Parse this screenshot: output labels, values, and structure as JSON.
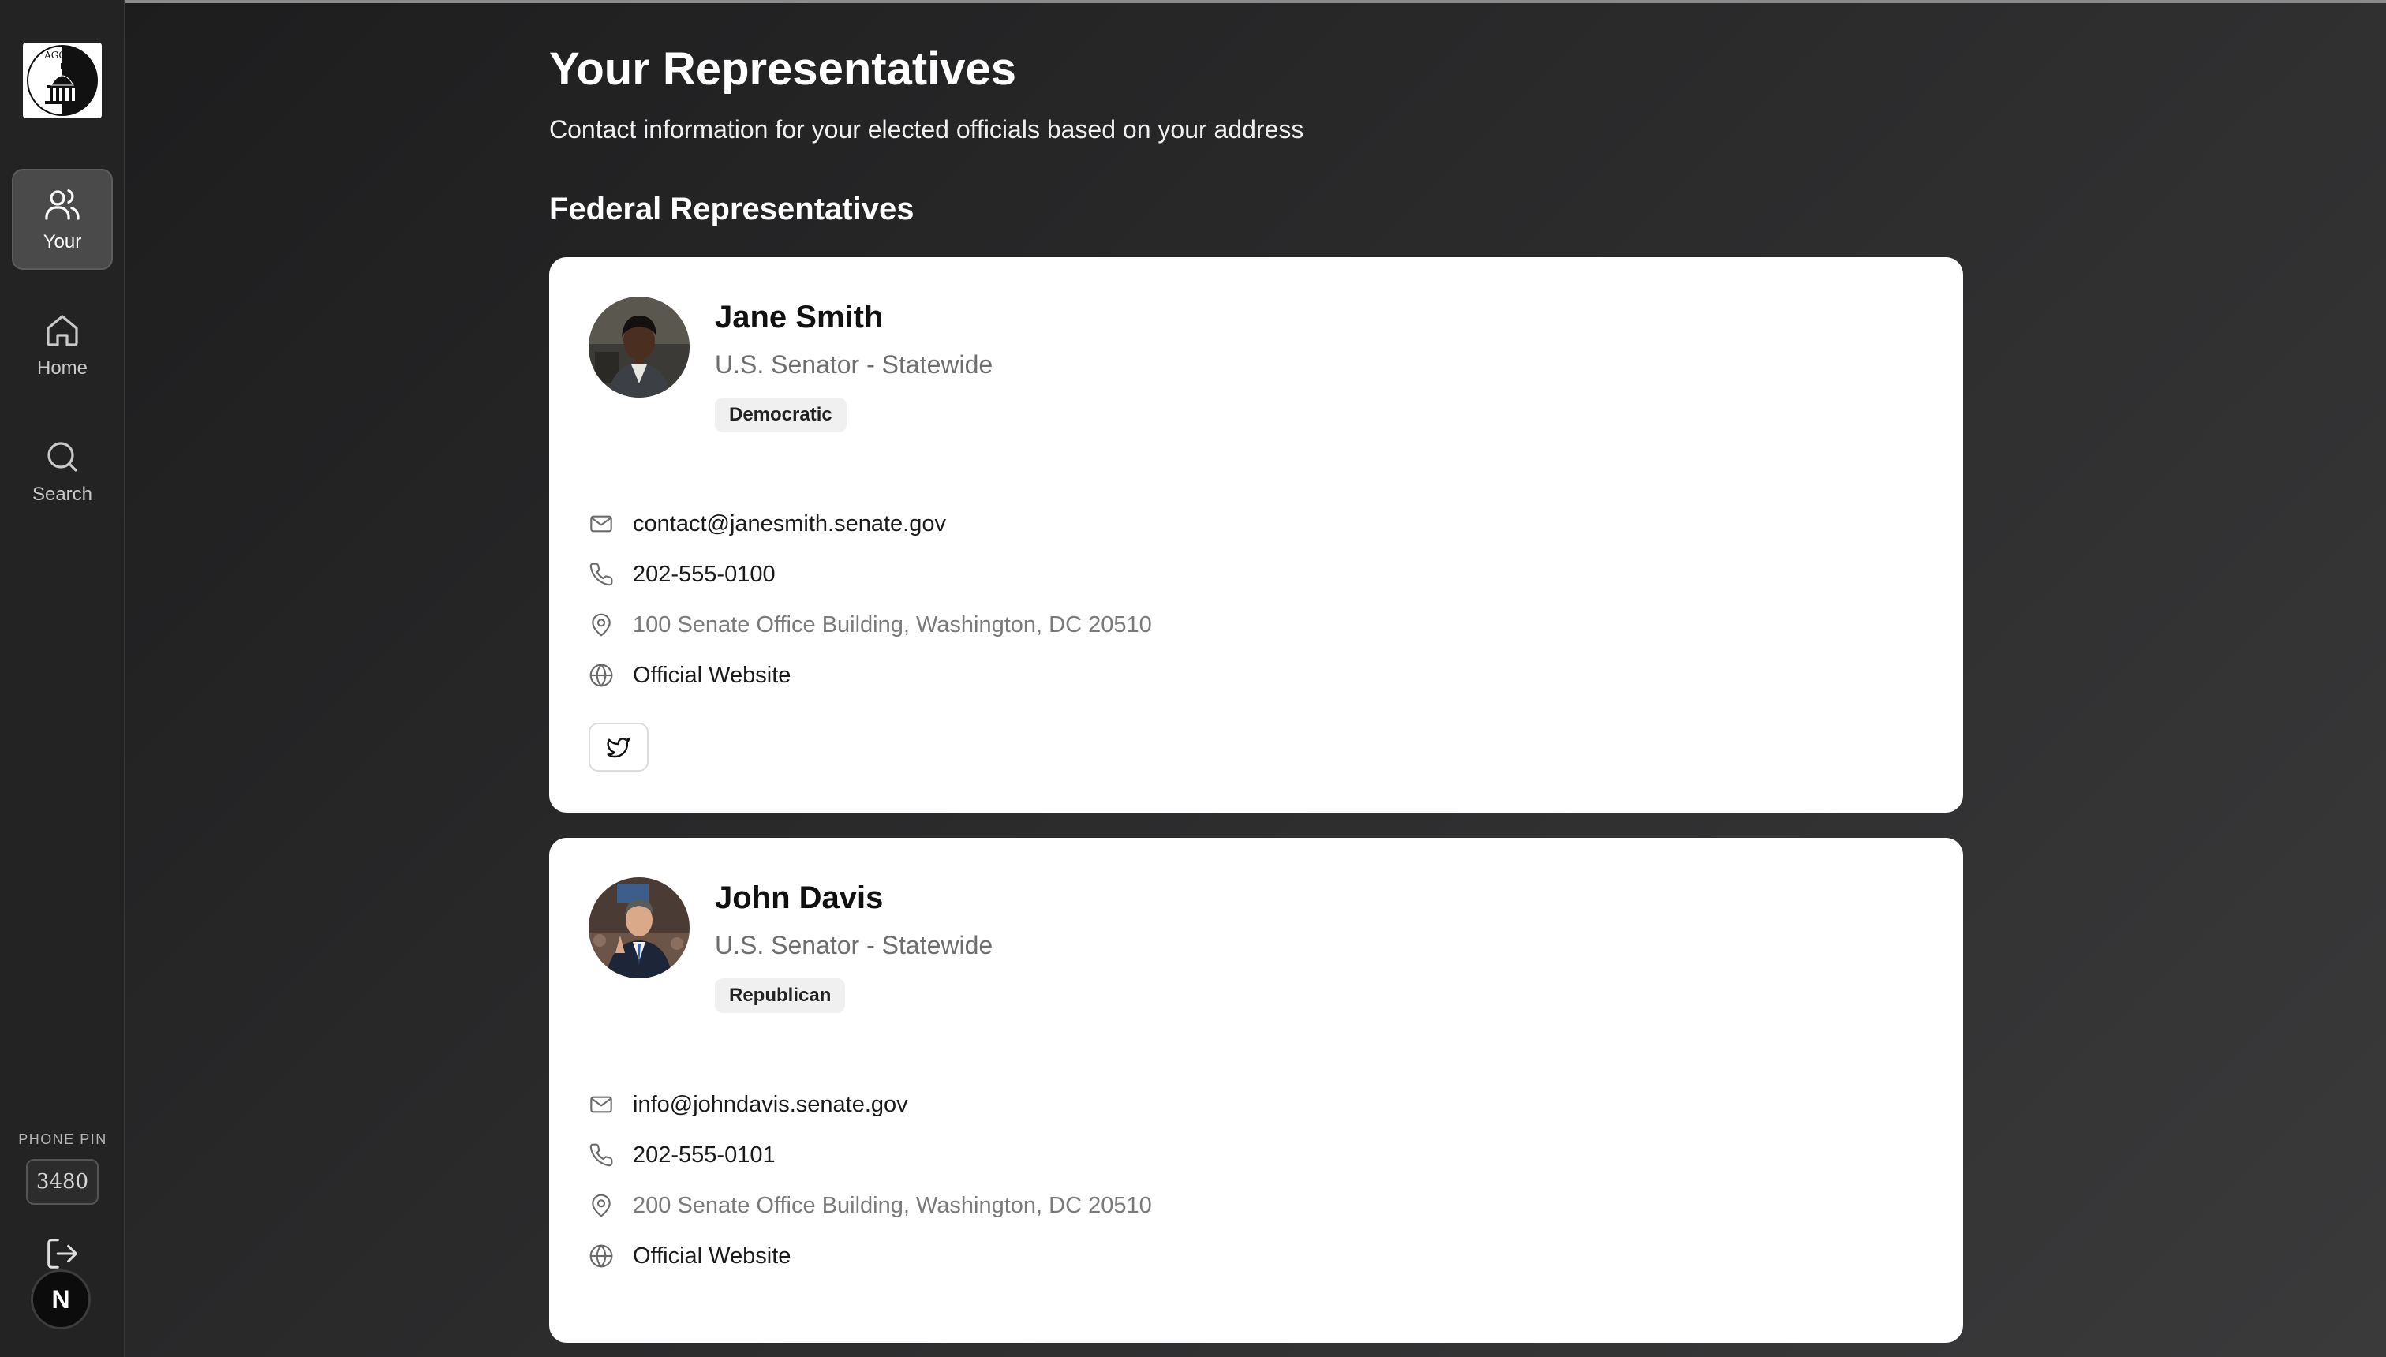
{
  "sidebar": {
    "logo_text": "AGORA",
    "items": [
      {
        "label": "Your",
        "icon": "users-icon",
        "active": true
      },
      {
        "label": "Home",
        "icon": "home-icon",
        "active": false
      },
      {
        "label": "Search",
        "icon": "search-icon",
        "active": false
      }
    ],
    "pin_label": "PHONE PIN",
    "pin_value": "3480",
    "avatar_initial": "N"
  },
  "header": {
    "title": "Your Representatives",
    "subtitle": "Contact information for your elected officials based on your address"
  },
  "section": {
    "title": "Federal Representatives"
  },
  "representatives": [
    {
      "name": "Jane Smith",
      "office": "U.S. Senator - Statewide",
      "party": "Democratic",
      "email": "contact@janesmith.senate.gov",
      "phone": "202-555-0100",
      "address": "100 Senate Office Building, Washington, DC 20510",
      "website_label": "Official Website",
      "social": "twitter-icon"
    },
    {
      "name": "John Davis",
      "office": "U.S. Senator - Statewide",
      "party": "Republican",
      "email": "info@johndavis.senate.gov",
      "phone": "202-555-0101",
      "address": "200 Senate Office Building, Washington, DC 20510",
      "website_label": "Official Website"
    }
  ],
  "colors": {
    "background": "#2a2a2b",
    "sidebar": "#232324",
    "card": "#ffffff",
    "badge": "#f0f0f0",
    "muted_text": "#6e6e6e"
  }
}
